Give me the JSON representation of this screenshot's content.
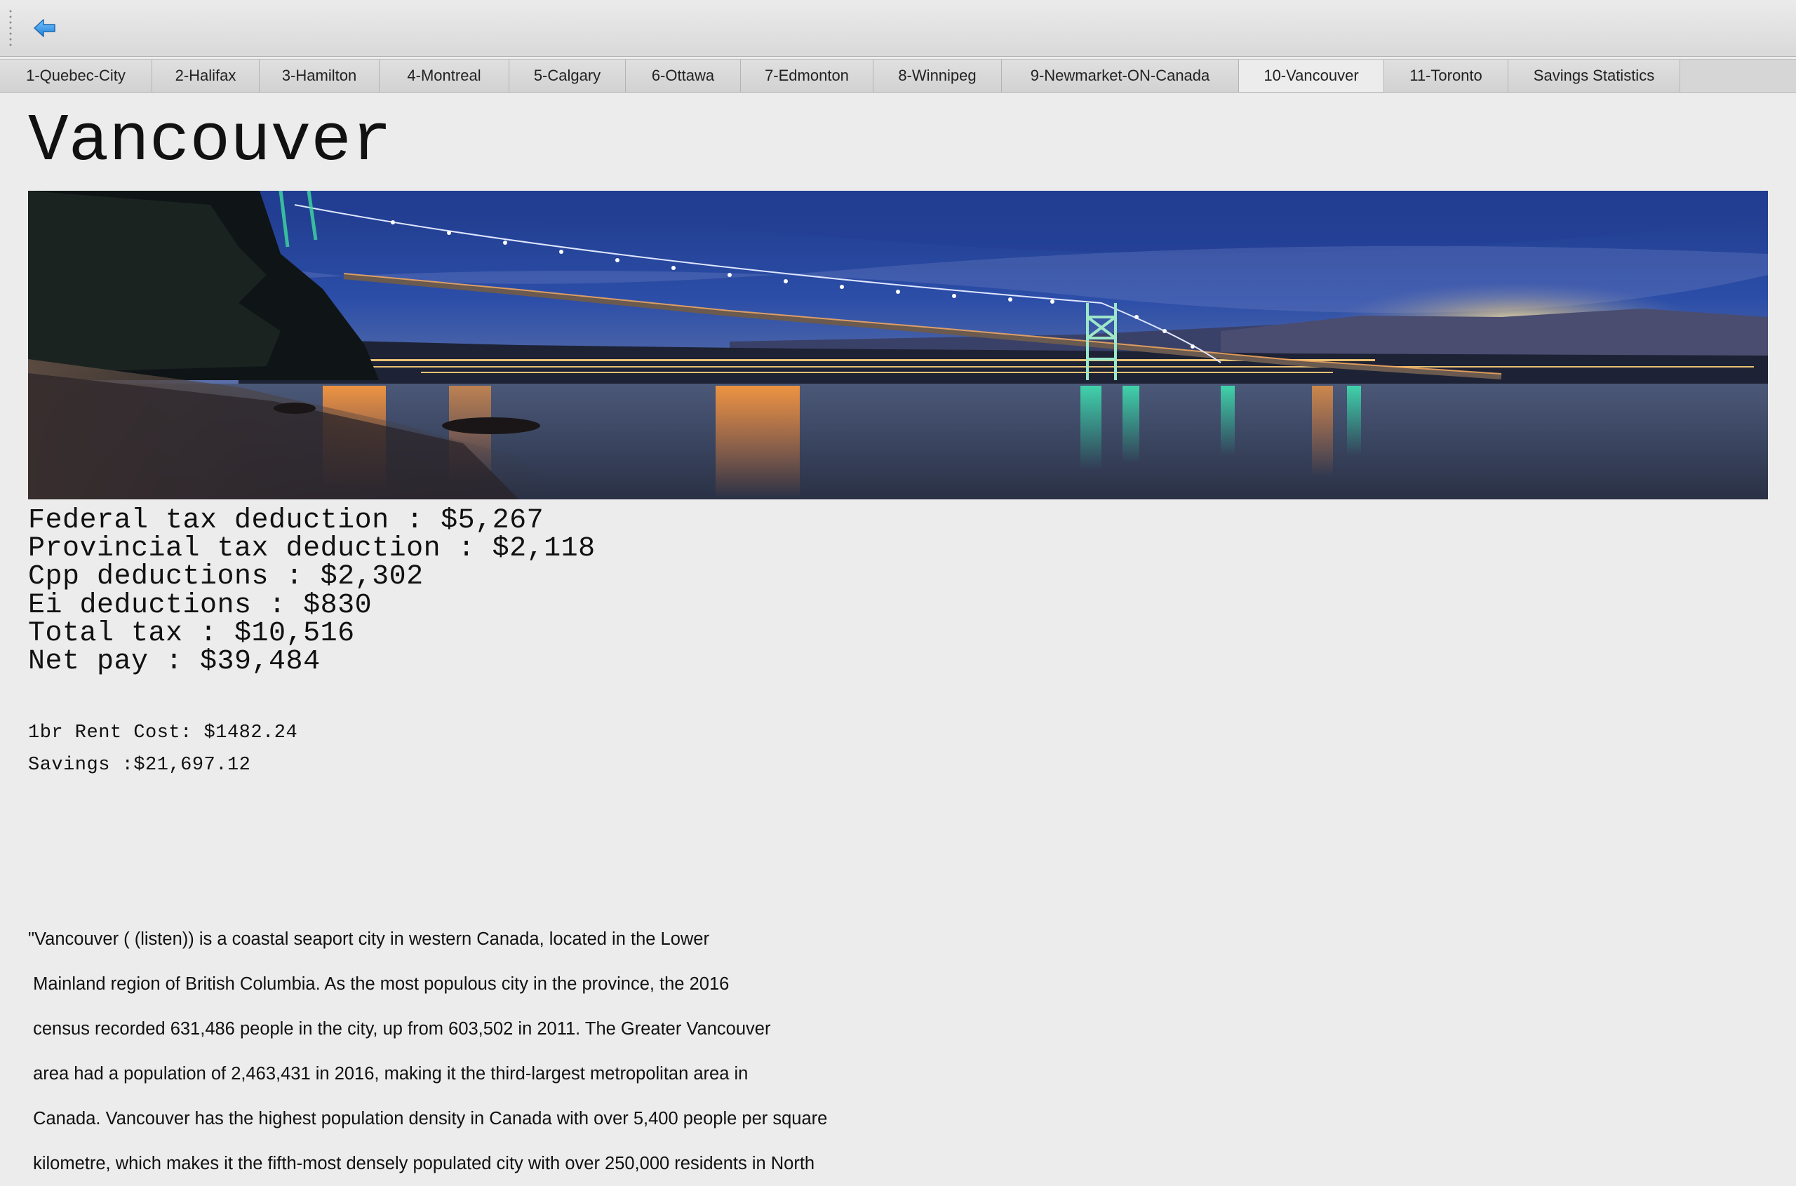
{
  "tabs": [
    {
      "label": "1-Quebec-City",
      "selected": false
    },
    {
      "label": "2-Halifax",
      "selected": false
    },
    {
      "label": "3-Hamilton",
      "selected": false
    },
    {
      "label": "4-Montreal",
      "selected": false
    },
    {
      "label": "5-Calgary",
      "selected": false
    },
    {
      "label": "6-Ottawa",
      "selected": false
    },
    {
      "label": "7-Edmonton",
      "selected": false
    },
    {
      "label": "8-Winnipeg",
      "selected": false
    },
    {
      "label": "9-Newmarket-ON-Canada",
      "selected": false
    },
    {
      "label": "10-Vancouver",
      "selected": true
    },
    {
      "label": "11-Toronto",
      "selected": false
    },
    {
      "label": "Savings Statistics",
      "selected": false
    }
  ],
  "toolbar": {
    "back_icon": "back-arrow-icon",
    "accent_color": "#2d8fe0"
  },
  "city": {
    "name": "Vancouver",
    "banner_image": "night-bridge-panorama"
  },
  "taxes": {
    "federal": "Federal tax deduction : $5,267",
    "provincial": "Provincial tax deduction : $2,118",
    "cpp": "Cpp deductions : $2,302",
    "ei": "Ei deductions : $830",
    "total": "Total tax : $10,516",
    "net": "Net pay : $39,484"
  },
  "costs": {
    "rent": "1br Rent Cost: $1482.24",
    "savings": "Savings :$21,697.12"
  },
  "description": [
    "\"Vancouver ( (listen)) is a coastal seaport city in western Canada, located in the Lower",
    " Mainland region of British Columbia. As the most populous city in the province, the 2016",
    " census recorded 631,486 people in the city, up from 603,502 in 2011. The Greater Vancouver",
    " area had a population of 2,463,431 in 2016, making it the third-largest metropolitan area in",
    " Canada. Vancouver has the highest population density in Canada with over 5,400 people per square",
    " kilometre, which makes it the fifth-most densely populated city with over 250,000 residents in North"
  ]
}
